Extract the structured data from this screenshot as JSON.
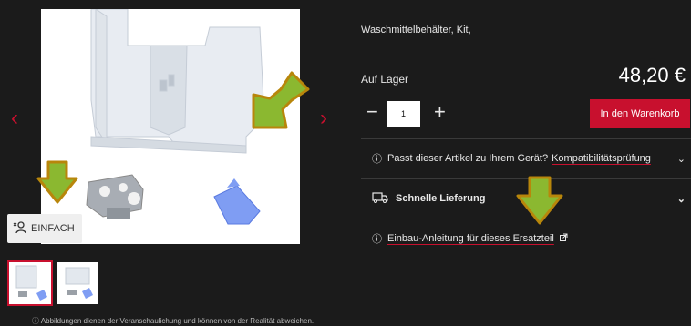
{
  "gallery": {
    "badge_label": "EINFACH",
    "disclaimer": "Abbildungen dienen der Veranschaulichung und können von der Realität abweichen.",
    "prev_icon": "chevron-left-icon",
    "next_icon": "chevron-right-icon"
  },
  "product": {
    "title": "Waschmittelbehälter, Kit,",
    "stock_status": "Auf Lager",
    "price": "48,20 €",
    "quantity": "1",
    "add_to_cart_label": "In den Warenkorb"
  },
  "info_rows": {
    "compatibility_prefix": "Passt dieser Artikel zu Ihrem Gerät?",
    "compatibility_link": "Kompatibilitätsprüfung",
    "delivery_label": "Schnelle Lieferung",
    "installation_link": "Einbau-Anleitung für dieses Ersatzteil"
  },
  "colors": {
    "accent": "#c8102e",
    "background": "#1b1b1b",
    "annotation_arrow": "#8bb830"
  }
}
